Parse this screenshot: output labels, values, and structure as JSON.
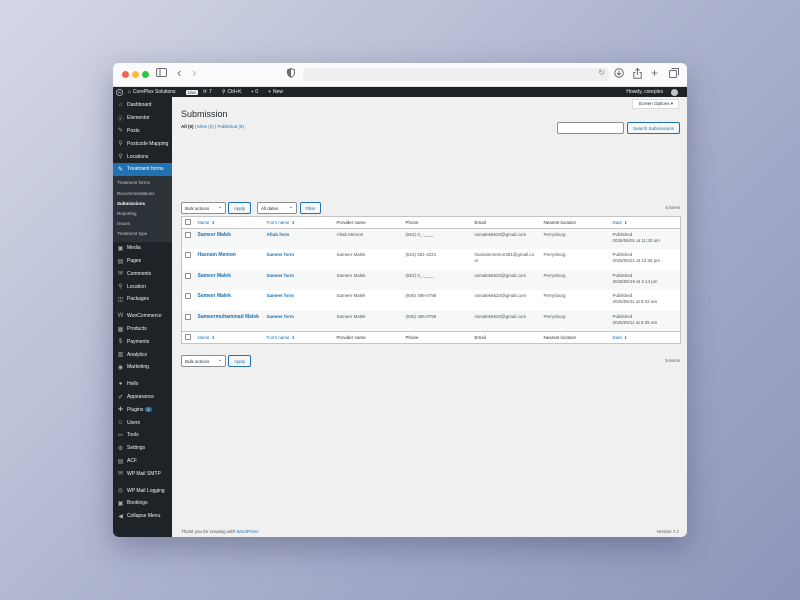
{
  "browser": {
    "nav_back": "‹",
    "nav_forward": "›"
  },
  "adminbar": {
    "site_name": "CorePlex Solutions",
    "live_badge": "Live",
    "updates": "7",
    "shortcut": "Ctrl+K",
    "comments": "0",
    "new_label": "New",
    "howdy": "Howdy, coreplex"
  },
  "sidebar": {
    "items_top": [
      {
        "label": "Dashboard",
        "icon": "⌂"
      },
      {
        "label": "Elementor",
        "icon": "ⓔ"
      },
      {
        "label": "Posts",
        "icon": "✎"
      },
      {
        "label": "Postcode Mapping",
        "icon": "⚲"
      },
      {
        "label": "Locations",
        "icon": "⚲"
      },
      {
        "label": "Treatment forms",
        "icon": "✎"
      }
    ],
    "submenu": [
      "Treatment forms",
      "Recommendations",
      "Submissions",
      "Reporting",
      "Issues",
      "Treatment type"
    ],
    "items_mid": [
      {
        "label": "Media",
        "icon": "▣"
      },
      {
        "label": "Pages",
        "icon": "▤"
      },
      {
        "label": "Comments",
        "icon": "✉"
      },
      {
        "label": "Location",
        "icon": "⚲"
      },
      {
        "label": "Packages",
        "icon": "◫"
      }
    ],
    "items_shop": [
      {
        "label": "WooCommerce",
        "icon": "W"
      },
      {
        "label": "Products",
        "icon": "▦"
      },
      {
        "label": "Payments",
        "icon": "$"
      },
      {
        "label": "Analytics",
        "icon": "▥"
      },
      {
        "label": "Marketing",
        "icon": "◉"
      }
    ],
    "items_tools": [
      {
        "label": "Hello",
        "icon": "●"
      },
      {
        "label": "Appearance",
        "icon": "✐"
      },
      {
        "label": "Plugins",
        "icon": "✚"
      },
      {
        "label": "Users",
        "icon": "☺"
      },
      {
        "label": "Tools",
        "icon": "✂"
      },
      {
        "label": "Settings",
        "icon": "⚙"
      },
      {
        "label": "ACF",
        "icon": "▤"
      },
      {
        "label": "WP Mail SMTP",
        "icon": "✉"
      }
    ],
    "items_bottom": [
      {
        "label": "WP Mail Logging",
        "icon": "◎"
      },
      {
        "label": "Bookings",
        "icon": "▣"
      },
      {
        "label": "Collapse Menu",
        "icon": "◀"
      }
    ],
    "plugins_badge": "1"
  },
  "main": {
    "screen_options": "Screen Options ▾",
    "title": "Submission",
    "views": {
      "all": "All (5)",
      "mine": "Mine (2)",
      "published": "Published (5)",
      "sep": "|"
    },
    "search_button": "Search Submissions",
    "bulk_actions": "Bulk actions",
    "apply": "Apply",
    "all_dates": "All dates",
    "filter": "Filter",
    "items_count": "5 items",
    "columns": [
      "Name",
      "Form name",
      "Provider name",
      "Phone",
      "Email",
      "Nearest location",
      "Date"
    ],
    "rows": [
      {
        "name": "Sameer Malek",
        "form": "Aftab form",
        "provider": "Aftab Memon",
        "phone": "(662) 0_-____",
        "email": "ssmalek6520@gmail.com",
        "location": "Perrysburg",
        "status": "Published",
        "date": "2026/06/01 at 11:33 am"
      },
      {
        "name": "Hasnain Memon",
        "form": "Sameer form",
        "provider": "Sameer Malek",
        "phone": "(815) 301-4221",
        "email": "hasnainmemon381@gmail.com",
        "location": "Perrysburg",
        "status": "Published",
        "date": "2026/05/21 at 12:35 pm"
      },
      {
        "name": "Sameer Malek",
        "form": "Sameer form",
        "provider": "Sameer Malek",
        "phone": "(652) 0_-____",
        "email": "ssmalek6520@gmail.com",
        "location": "Perrysburg",
        "status": "Published",
        "date": "2026/05/19 at 4:14 pm"
      },
      {
        "name": "Sameer Malek",
        "form": "Sameer form",
        "provider": "Sameer Malek",
        "phone": "(605) 495-0796",
        "email": "ssmalek6520@gmail.com",
        "location": "Perrysburg",
        "status": "Published",
        "date": "2026/05/11 at 6:42 am"
      },
      {
        "name": "Sameermuhammad Malek",
        "form": "Sameer form",
        "provider": "Sameer Malek",
        "phone": "(605) 495-0796",
        "email": "ssmalek6520@gmail.com",
        "location": "Perrysburg",
        "status": "Published",
        "date": "2026/05/11 at 6:35 am"
      }
    ]
  },
  "footer": {
    "thanks_prefix": "Thank you for creating with ",
    "thanks_link": "WordPress",
    "version": "Version 7.1"
  }
}
